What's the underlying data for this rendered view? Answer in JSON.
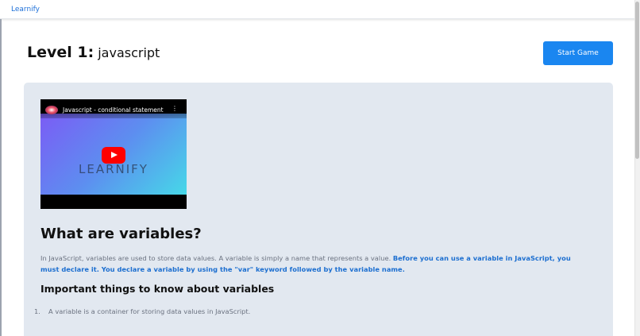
{
  "app": {
    "brand": "Learnify"
  },
  "header": {
    "level_label": "Level 1:",
    "level_name": "javascript",
    "start_button": "Start Game"
  },
  "video": {
    "title": "Javascript - conditional statement",
    "watermark": "LEARNIFY",
    "menu_icon": "kebab-vertical-icon",
    "play_icon": "play-icon"
  },
  "content": {
    "heading": "What are variables?",
    "paragraph_plain": "In JavaScript, variables are used to store data values. A variable is simply a name that represents a value. ",
    "paragraph_emphasis": "Before you can use a variable in JavaScript, you must declare it. You declare a variable by using the \"var\" keyword followed by the variable name.",
    "subheading": "Important things to know about variables",
    "list": [
      {
        "number": "1.",
        "text": "A variable is a container for storing data values in JavaScript."
      }
    ]
  },
  "colors": {
    "accent": "#1a86f0",
    "brand_link": "#1c6fd8",
    "panel": "#e2e8f0",
    "emphasis": "#1d6fd0",
    "play": "#ff0000"
  }
}
